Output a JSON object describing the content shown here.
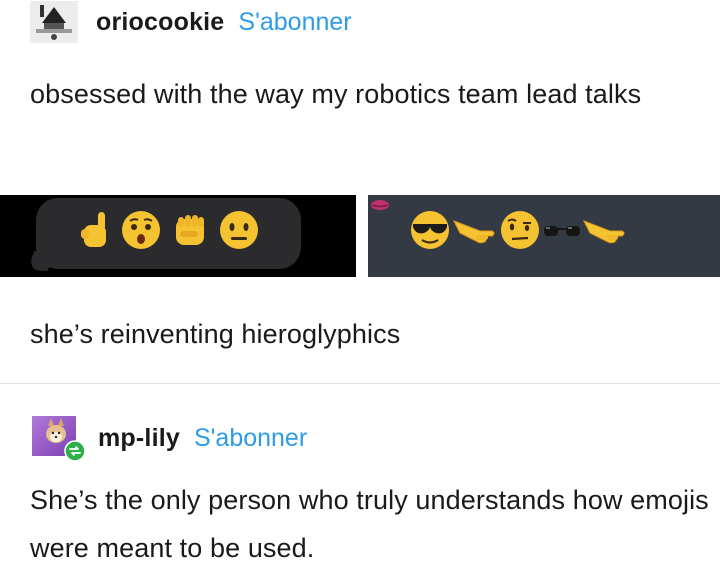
{
  "posts": [
    {
      "username": "oriocookie",
      "follow_label": "S'abonner",
      "avatar": "user-avatar",
      "body_text_1": "obsessed with the way my robotics team lead talks",
      "emoji_screenshot_left": [
        "pinky-point-up-emoji",
        "worried-face-emoji",
        "raised-fist-emoji",
        "neutral-face-emoji"
      ],
      "emoji_screenshot_right": [
        "sunglasses-face-emoji",
        "pointing-hand-emoji",
        "raised-eyebrow-face-emoji",
        "sunglasses-emoji",
        "pointing-hand-emoji"
      ],
      "body_text_2": "she’s reinventing hieroglyphics"
    },
    {
      "username": "mp-lily",
      "follow_label": "S'abonner",
      "avatar": "dog-avatar",
      "reblog_badge": "reblog-icon",
      "body_text": "She’s the only person who truly understands how emojis were meant to be used."
    }
  ],
  "colors": {
    "follow_link": "#2d9be6",
    "text": "#1a1a1a",
    "emoji_yellow": "#f5c332",
    "screenshot_dark": "#000000",
    "screenshot_slate": "#343a44",
    "reblog_green": "#30b04a"
  }
}
